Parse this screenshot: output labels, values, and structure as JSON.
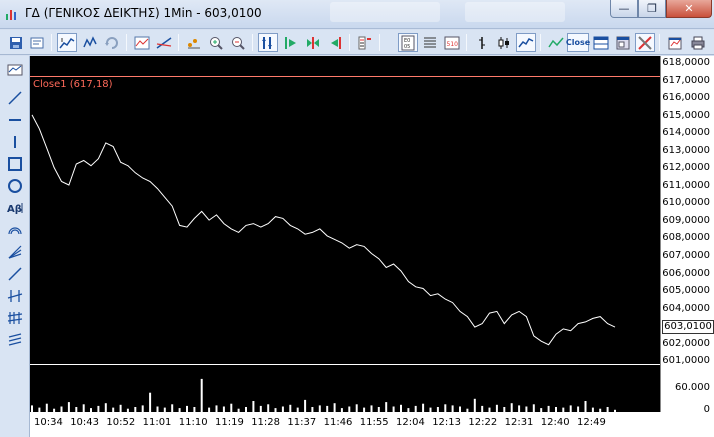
{
  "window": {
    "title": "ΓΔ (ΓΕΝΙΚΟΣ ΔΕΙΚΤΗΣ) 1Min - 603,0100",
    "min_symbol": "—",
    "max_symbol": "❐",
    "close_symbol": "✕"
  },
  "toolbar": {
    "close_label": "Close",
    "icons": [
      "save-icon",
      "properties-icon",
      "crosshair-icon",
      "chart-style-icon",
      "refresh-icon",
      "indicator-icon",
      "trendline-icon",
      "dots-icon",
      "zoom-in-icon",
      "zoom-out-icon",
      "fit-icon",
      "play-icon",
      "step-icon",
      "rewind-icon",
      "numbers-icon",
      "scale-icon",
      "grid-icon",
      "scale10-icon",
      "bar-icon",
      "candle-icon",
      "line-icon",
      "mountain-icon",
      "close-series-icon",
      "panel-icon",
      "window-icon",
      "tools-icon",
      "export-icon",
      "print-icon"
    ]
  },
  "sidebar": {
    "icons": [
      "cursor-icon",
      "line-tool-icon",
      "horizontal-line-icon",
      "vertical-line-icon",
      "rectangle-icon",
      "ellipse-icon",
      "text-tool-icon",
      "arc-icon",
      "fan-icon",
      "ray-icon",
      "channel-icon",
      "fibonacci-icon",
      "regression-icon"
    ]
  },
  "chart": {
    "legend": "Close1 (617,18)",
    "current_price": "603,0100",
    "volume_label": "60.000",
    "volume_zero": "0",
    "colors": {
      "price_line": "#ffffff",
      "volume_bar": "#ffffff",
      "legend": "#ff6a5a",
      "separator": "#ff7a6a"
    }
  },
  "chart_data": {
    "type": "line",
    "series": [
      {
        "name": "Close1",
        "values": [
          615.1,
          614.3,
          613.2,
          612.1,
          611.3,
          611.1,
          612.3,
          612.5,
          612.2,
          612.6,
          613.5,
          613.3,
          612.4,
          612.2,
          611.8,
          611.5,
          611.3,
          610.9,
          610.4,
          609.9,
          608.8,
          608.7,
          609.2,
          609.6,
          609.1,
          609.4,
          608.9,
          608.6,
          608.4,
          608.8,
          608.9,
          608.7,
          608.9,
          609.3,
          609.2,
          608.8,
          608.6,
          608.3,
          608.4,
          608.6,
          608.2,
          608.0,
          607.8,
          607.5,
          607.7,
          607.6,
          607.2,
          606.9,
          606.4,
          606.6,
          606.2,
          605.6,
          605.3,
          605.2,
          604.8,
          604.9,
          604.6,
          604.4,
          603.9,
          603.6,
          603.0,
          603.2,
          603.8,
          603.9,
          603.2,
          603.7,
          603.9,
          603.6,
          602.5,
          602.2,
          602.0,
          602.6,
          602.9,
          602.8,
          603.2,
          603.3,
          603.5,
          603.6,
          603.2,
          603.0
        ]
      }
    ],
    "volume": [
      12,
      8,
      15,
      6,
      10,
      18,
      9,
      14,
      7,
      11,
      16,
      8,
      13,
      6,
      9,
      12,
      35,
      10,
      8,
      14,
      7,
      11,
      9,
      60,
      8,
      12,
      10,
      15,
      6,
      9,
      20,
      11,
      14,
      7,
      10,
      13,
      8,
      22,
      9,
      12,
      11,
      16,
      7,
      10,
      14,
      8,
      12,
      9,
      18,
      10,
      13,
      7,
      11,
      15,
      8,
      9,
      14,
      12,
      10,
      6,
      24,
      11,
      8,
      13,
      9,
      16,
      12,
      10,
      14,
      7,
      11,
      9,
      8,
      12,
      10,
      20,
      8,
      6,
      9,
      4
    ],
    "x_tick_labels": [
      "10:34",
      "10:43",
      "10:52",
      "11:01",
      "11:10",
      "11:19",
      "11:28",
      "11:37",
      "11:46",
      "11:55",
      "12:04",
      "12:13",
      "12:22",
      "12:31",
      "12:40",
      "12:49"
    ],
    "y_tick_labels": [
      "618,0000",
      "617,0000",
      "616,0000",
      "615,0000",
      "614,0000",
      "613,0000",
      "612,0000",
      "611,0000",
      "610,0000",
      "609,0000",
      "608,0000",
      "607,0000",
      "606,0000",
      "605,0000",
      "604,0000",
      "603,0000",
      "602,0000",
      "601,0000"
    ],
    "ylim": [
      600.5,
      618.0
    ],
    "volume_ylim": [
      0,
      100000
    ],
    "grid": false
  }
}
